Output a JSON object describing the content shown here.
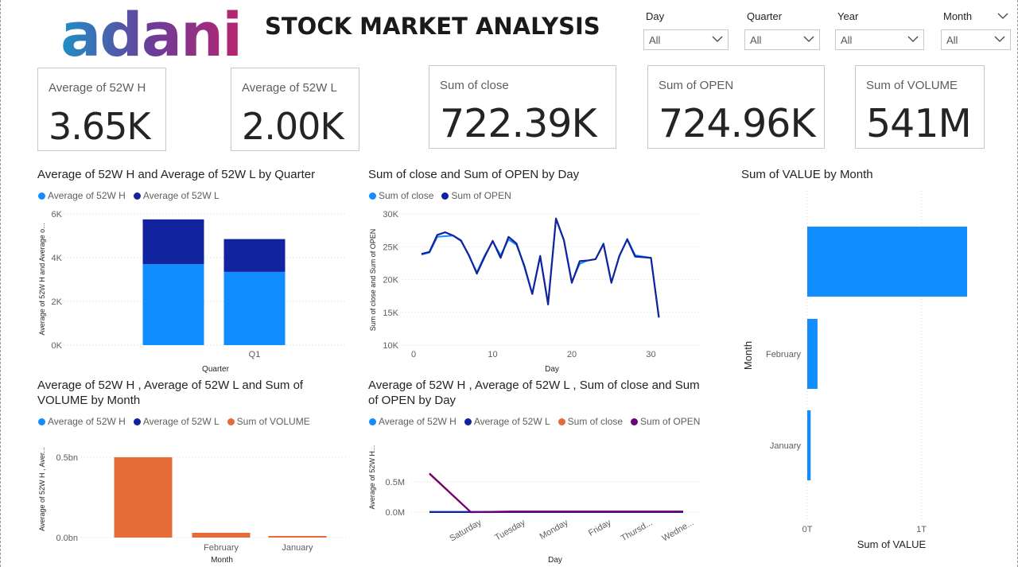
{
  "logo": {
    "text": "adani"
  },
  "header": {
    "title": "STOCK MARKET ANALYSIS"
  },
  "slicers": [
    {
      "label": "Day",
      "value": "All"
    },
    {
      "label": "Quarter",
      "value": "All"
    },
    {
      "label": "Year",
      "value": "All"
    },
    {
      "label": "Month",
      "value": "All"
    }
  ],
  "cards": [
    {
      "label": "Average of 52W H",
      "value": "3.65K"
    },
    {
      "label": "Average of 52W L",
      "value": "2.00K"
    },
    {
      "label": "Sum of close",
      "value": "722.39K"
    },
    {
      "label": "Sum of OPEN",
      "value": "724.96K"
    },
    {
      "label": "Sum of VOLUME",
      "value": "541M"
    }
  ],
  "colors": {
    "light_blue": "#118dff",
    "dark_blue": "#12239e",
    "orange": "#e66c37",
    "purple": "#6b007b"
  },
  "chart_data": [
    {
      "type": "bar",
      "title": "Average of 52W H and Average of 52W L by Quarter",
      "xlabel": "Quarter",
      "ylabel": "Average of 52W H and Average o...",
      "categories": [
        "",
        "Q1"
      ],
      "series": [
        {
          "name": "Average of 52W H",
          "values": [
            3700,
            3350
          ]
        },
        {
          "name": "Average of 52W L",
          "values": [
            2050,
            1500
          ]
        }
      ],
      "stacked": true,
      "ylim": [
        0,
        6000
      ],
      "yticks": [
        "0K",
        "2K",
        "4K",
        "6K"
      ],
      "legend": "top-left"
    },
    {
      "type": "line",
      "title": "Sum of close and Sum of OPEN by Day",
      "xlabel": "Day",
      "ylabel": "Sum of close and Sum of OPEN",
      "x": [
        1,
        2,
        3,
        4,
        5,
        6,
        7,
        8,
        9,
        10,
        11,
        12,
        13,
        14,
        15,
        16,
        17,
        18,
        19,
        20,
        21,
        22,
        23,
        24,
        25,
        26,
        27,
        28,
        29,
        30,
        31
      ],
      "series": [
        {
          "name": "Sum of close",
          "values": [
            23800,
            24100,
            26500,
            26600,
            26700,
            26000,
            23600,
            21100,
            23700,
            25800,
            23700,
            26100,
            25300,
            22200,
            17800,
            23500,
            16400,
            29200,
            26000,
            19700,
            22400,
            22900,
            23100,
            25500,
            19600,
            23500,
            26200,
            23700,
            23500,
            23300,
            14300
          ]
        },
        {
          "name": "Sum of OPEN",
          "values": [
            23900,
            24200,
            26800,
            27200,
            26700,
            25900,
            23700,
            20900,
            23500,
            25900,
            23300,
            26500,
            25500,
            22000,
            17800,
            23600,
            16200,
            29300,
            26000,
            19500,
            22800,
            22900,
            23100,
            25400,
            19500,
            23600,
            26100,
            23500,
            23400,
            23300,
            14200
          ]
        }
      ],
      "ylim": [
        10000,
        30000
      ],
      "yticks": [
        "10K",
        "15K",
        "20K",
        "25K",
        "30K"
      ],
      "xticks": [
        "0",
        "10",
        "20",
        "30"
      ],
      "legend": "top-left"
    },
    {
      "type": "bar",
      "title": "Sum of VALUE by Month",
      "orientation": "horizontal",
      "xlabel": "Sum of VALUE",
      "ylabel": "Month",
      "categories": [
        "",
        "February",
        "January"
      ],
      "values": [
        1.4,
        0.09,
        0.03
      ],
      "xticks": [
        "0T",
        "1T"
      ],
      "xlim": [
        0,
        1.4
      ]
    },
    {
      "type": "bar",
      "title": "Average of 52W H , Average of 52W L and Sum of VOLUME by Month",
      "xlabel": "Month",
      "ylabel": "Average of 52W H , Aver...",
      "categories": [
        "",
        "February",
        "January"
      ],
      "series": [
        {
          "name": "Average of 52W H",
          "values": [
            0,
            0,
            0
          ]
        },
        {
          "name": "Average of 52W L",
          "values": [
            0,
            0,
            0
          ]
        },
        {
          "name": "Sum of VOLUME",
          "values": [
            0.5,
            0.03,
            0.01
          ]
        }
      ],
      "ylim": [
        0,
        0.5
      ],
      "yticks": [
        "0.0bn",
        "0.5bn"
      ],
      "legend": "top-left"
    },
    {
      "type": "line",
      "title": "Average of 52W H , Average of 52W L , Sum of close and Sum of OPEN by Day",
      "xlabel": "Day",
      "ylabel": "Average of 52W H...",
      "categories": [
        "",
        "Saturday",
        "Tuesday",
        "Monday",
        "Friday",
        "Thursd...",
        "Wedne..."
      ],
      "series": [
        {
          "name": "Average of 52W H",
          "values": [
            0.004,
            0.004,
            0.004,
            0.004,
            0.004,
            0.004,
            0.004
          ]
        },
        {
          "name": "Average of 52W L",
          "values": [
            0.002,
            0.002,
            0.002,
            0.002,
            0.002,
            0.002,
            0.002
          ]
        },
        {
          "name": "Sum of close",
          "values": [
            0.63,
            0.0,
            0.01,
            0.01,
            0.01,
            0.01,
            0.01
          ]
        },
        {
          "name": "Sum of OPEN",
          "values": [
            0.64,
            0.0,
            0.01,
            0.01,
            0.01,
            0.01,
            0.01
          ]
        }
      ],
      "yticks": [
        "0.0M",
        "0.5M"
      ],
      "ylim": [
        0,
        0.75
      ],
      "legend": "top-left"
    }
  ]
}
